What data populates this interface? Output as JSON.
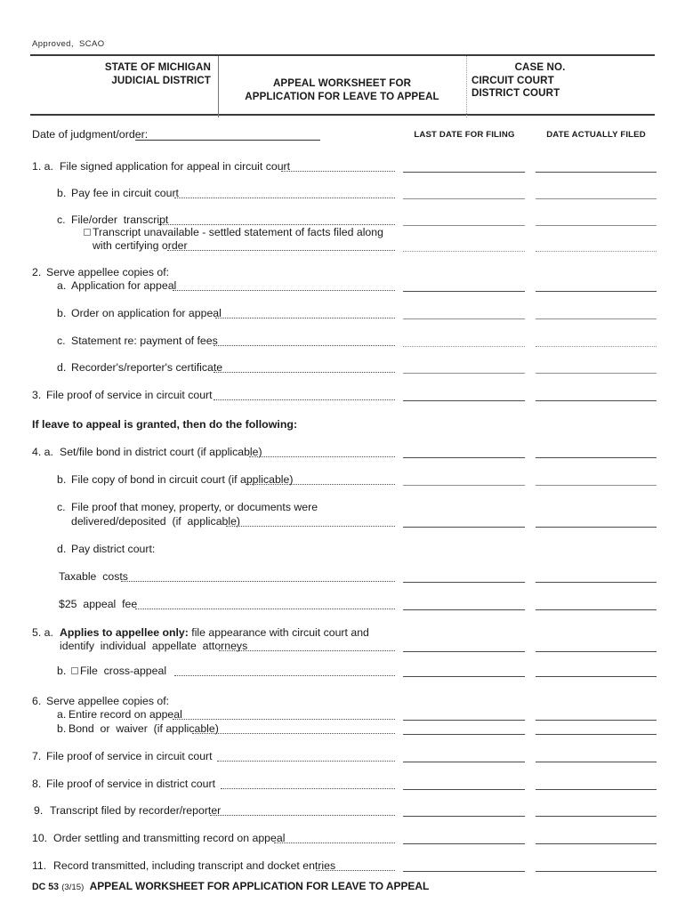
{
  "document": {
    "approved_note": "Approved,  SCAO",
    "header": {
      "state_line1": "STATE OF MICHIGAN",
      "state_line2": "JUDICIAL DISTRICT",
      "form_title_line1": "APPEAL WORKSHEET FOR",
      "form_title_line2": "APPLICATION FOR LEAVE TO APPEAL",
      "case_no_label": "CASE NO.",
      "circuit_court_label": "CIRCUIT COURT",
      "district_court_label": "DISTRICT COURT"
    },
    "date_of_judgment": {
      "label": "Date of judgment/order:",
      "value": ""
    },
    "columns": {
      "last_date_for_filing": "LAST DATE FOR FILING",
      "date_actually_filed": "DATE ACTUALLY FILED"
    },
    "section_heading": "If leave to appeal is granted, then do the following:",
    "items": [
      {
        "num": "1. a.",
        "text": "File signed application for appeal in circuit court"
      },
      {
        "num": "b.",
        "text": "Pay fee in circuit court"
      },
      {
        "num": "c.",
        "text": "File/order  transcript"
      },
      {
        "num": "",
        "text": "Transcript unavailable - settled statement of facts filed along"
      },
      {
        "num": "",
        "text": "with certifying order"
      },
      {
        "num": "2.",
        "text": "Serve appellee copies of:"
      },
      {
        "num": "a.",
        "text": "Application for appeal"
      },
      {
        "num": "b.",
        "text": "Order on application for appeal"
      },
      {
        "num": "c.",
        "text": "Statement re: payment of fees"
      },
      {
        "num": "d.",
        "text": "Recorder's/reporter's certificate"
      },
      {
        "num": "3.",
        "text": "File proof of service in circuit court"
      },
      {
        "num": "4. a.",
        "text": "Set/file bond in district court (if applicable)"
      },
      {
        "num": "b.",
        "text": "File copy of bond in circuit court (if applicable)"
      },
      {
        "num": "c.",
        "text": "File proof that money, property, or documents were"
      },
      {
        "num": "",
        "text": "delivered/deposited  (if  applicable)"
      },
      {
        "num": "d.",
        "text": "Pay district court:"
      },
      {
        "num": "",
        "text": "Taxable  costs"
      },
      {
        "num": "",
        "text": "$25  appeal  fee"
      },
      {
        "num": "5. a.",
        "text_bold": "Applies to appellee only:",
        "text": " file appearance with circuit court and"
      },
      {
        "num": "",
        "text": "identify  individual  appellate  attorneys"
      },
      {
        "num": "b.",
        "text": "File  cross-appeal"
      },
      {
        "num": "6.",
        "text": "Serve appellee copies of:"
      },
      {
        "num": "a.",
        "text": "Entire record on appeal"
      },
      {
        "num": "b.",
        "text": "Bond  or  waiver  (if applicable)"
      },
      {
        "num": "7.",
        "text": "File proof of service in circuit court"
      },
      {
        "num": "8.",
        "text": "File proof of service in district court"
      },
      {
        "num": "9.",
        "text": "Transcript filed by recorder/reporter"
      },
      {
        "num": "10.",
        "text": "Order settling and transmitting record on appeal"
      },
      {
        "num": "11.",
        "text": "Record transmitted, including transcript and docket entries"
      }
    ],
    "footer": {
      "form_code": "DC 53",
      "revision": "(3/15)",
      "title": "APPEAL WORKSHEET FOR APPLICATION FOR LEAVE TO APPEAL"
    },
    "colors": {
      "ink": "#1a1a1a",
      "rule": "#4a4a4a",
      "faint_rule": "#8d8d8d",
      "paper": "#ffffff"
    }
  }
}
